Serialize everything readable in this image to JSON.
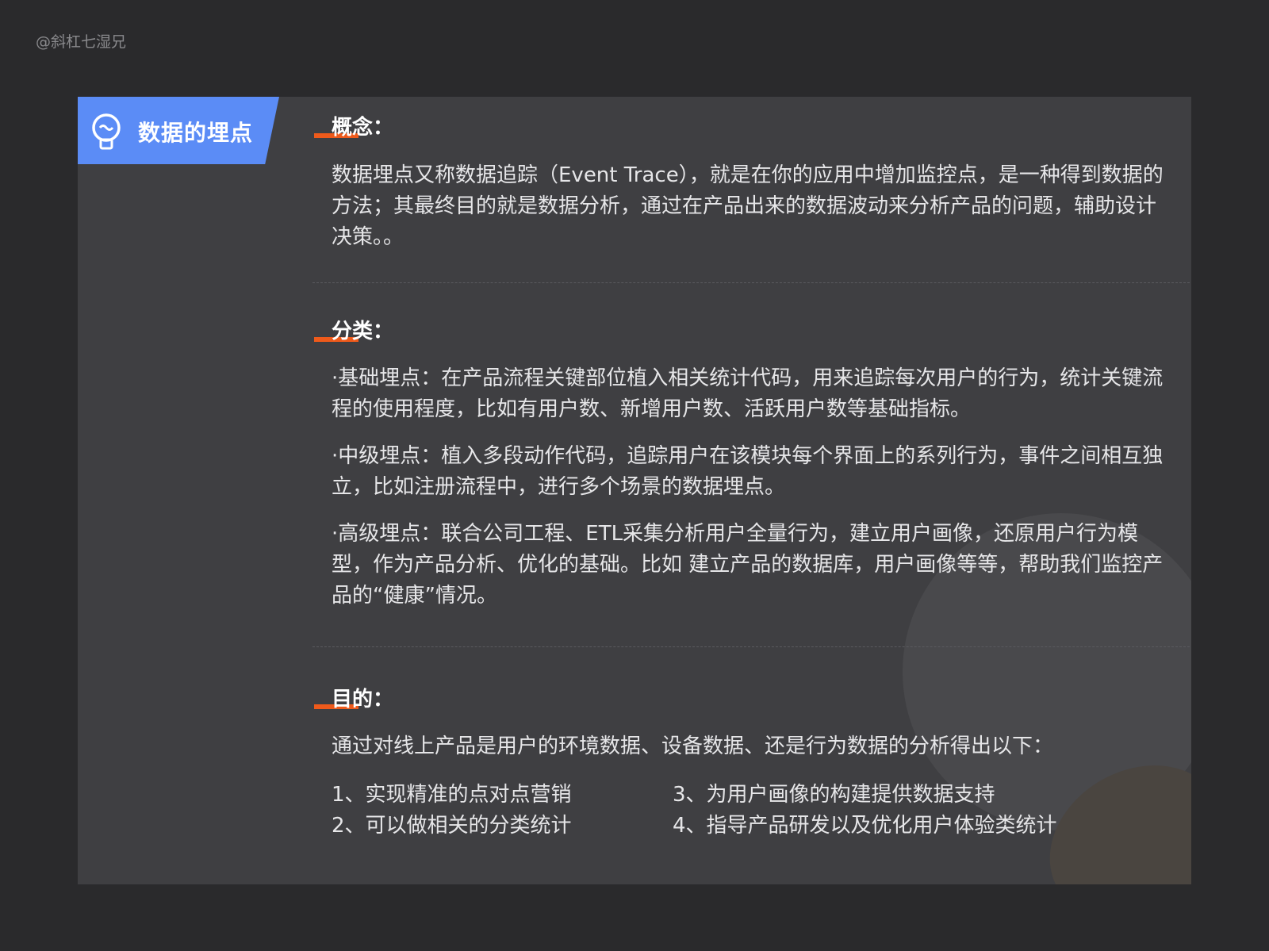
{
  "watermark": "@斜杠七湿兄",
  "badge": {
    "icon": "lightbulb-icon",
    "title": "数据的埋点",
    "color": "#5b8cf6"
  },
  "accent_color": "#ee5a1b",
  "concept": {
    "title": "概念：",
    "text": "数据埋点又称数据追踪（Event Trace），就是在你的应用中增加监控点，是一种得到数据的方法；其最终目的就是数据分析，通过在产品出来的数据波动来分析产品的问题，辅助设计决策。。"
  },
  "classification": {
    "title": "分类：",
    "items": [
      "·基础埋点：在产品流程关键部位植入相关统计代码，用来追踪每次用户的行为，统计关键流程的使用程度，比如有用户数、新增用户数、活跃用户数等基础指标。",
      "·中级埋点：植入多段动作代码，追踪用户在该模块每个界面上的系列行为，事件之间相互独立，比如注册流程中，进行多个场景的数据埋点。",
      "·高级埋点：联合公司工程、ETL采集分析用户全量行为，建立用户画像，还原用户行为模型，作为产品分析、优化的基础。比如 建立产品的数据库，用户画像等等，帮助我们监控产品的“健康”情况。"
    ]
  },
  "purpose": {
    "title": "目的：",
    "intro": "通过对线上产品是用户的环境数据、设备数据、还是行为数据的分析得出以下：",
    "items": [
      "1、实现精准的点对点营销",
      "2、可以做相关的分类统计",
      "3、为用户画像的构建提供数据支持",
      "4、指导产品研发以及优化用户体验类统计"
    ]
  }
}
